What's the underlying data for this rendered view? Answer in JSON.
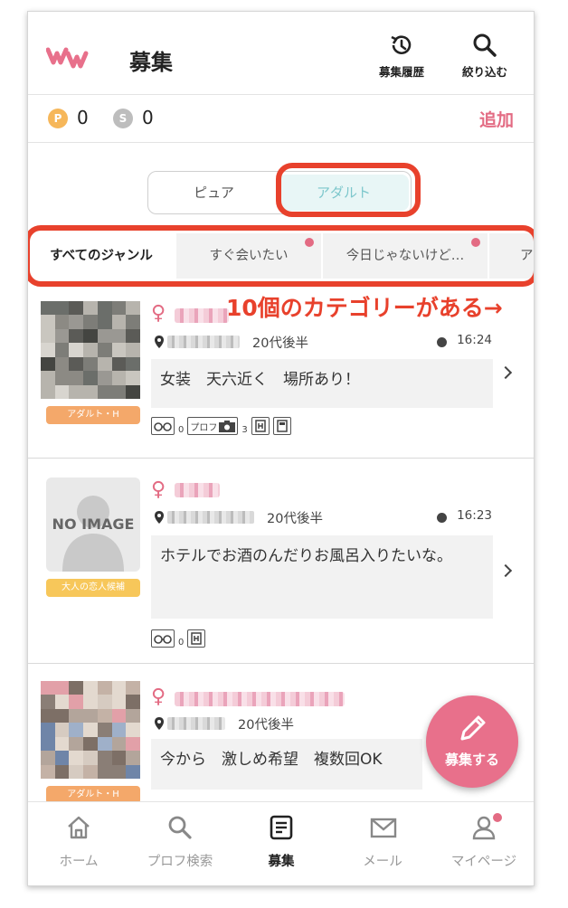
{
  "header": {
    "title": "募集",
    "history_label": "募集履歴",
    "filter_label": "絞り込む",
    "logo_text": "WW"
  },
  "points": {
    "p_symbol": "P",
    "p_value": "0",
    "s_symbol": "S",
    "s_value": "0",
    "add_label": "追加"
  },
  "mode_toggle": {
    "pure_label": "ピュア",
    "adult_label": "アダルト",
    "selected": "アダルト"
  },
  "genre_tabs": [
    {
      "label": "すべてのジャンル",
      "active": true,
      "dot": false
    },
    {
      "label": "すぐ会いたい",
      "active": false,
      "dot": true
    },
    {
      "label": "今日じゃないけど…",
      "active": false,
      "dot": true
    },
    {
      "label": "ア",
      "active": false,
      "dot": false
    }
  ],
  "annotation": "10個のカテゴリーがある→",
  "posts": [
    {
      "category": "アダルト・H",
      "age": "20代後半",
      "time": "16:24",
      "message": "女装　天六近く　場所あり！",
      "badge_glasses_count": "0",
      "badge_profile_label": "プロフ",
      "badge_photo_count": "3"
    },
    {
      "category": "大人の恋人候補",
      "no_image_label": "NO IMAGE",
      "age": "20代後半",
      "time": "16:23",
      "message": "ホテルでお酒のんだりお風呂入りたいな。",
      "badge_glasses_count": "0"
    },
    {
      "category": "アダルト・H",
      "age": "20代後半",
      "message": "今から　激しめ希望　複数回OK"
    }
  ],
  "fab": {
    "label": "募集する"
  },
  "nav": [
    {
      "label": "ホーム",
      "icon": "home-icon"
    },
    {
      "label": "プロフ検索",
      "icon": "search-icon"
    },
    {
      "label": "募集",
      "icon": "list-icon",
      "active": true
    },
    {
      "label": "メール",
      "icon": "mail-icon"
    },
    {
      "label": "マイページ",
      "icon": "person-icon",
      "dot": true
    }
  ],
  "colors": {
    "accent_pink": "#e36b83",
    "annotation_red": "#e8412c",
    "teal": "#7dc7cc",
    "coin_p": "#f6b75a",
    "coin_s": "#bdbdbd"
  }
}
